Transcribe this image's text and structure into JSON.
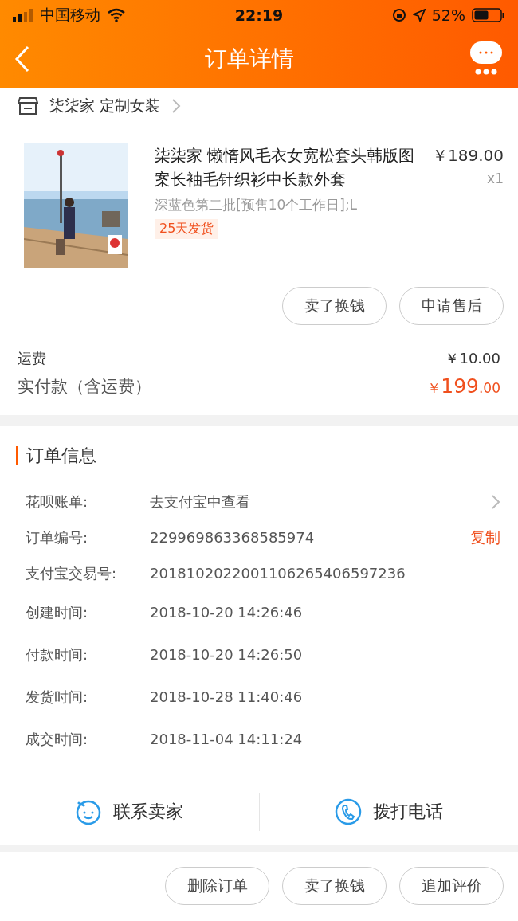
{
  "status_bar": {
    "carrier": "中国移动",
    "time": "22:19",
    "battery": "52%"
  },
  "nav": {
    "title": "订单详情"
  },
  "shop": {
    "name": "柒柒家 定制女装"
  },
  "product": {
    "title": "柒柒家 懒惰风毛衣女宽松套头韩版图案长袖毛针织衫中长款外套",
    "price": "￥189.00",
    "quantity": "x1",
    "sku": "深蓝色第二批[预售10个工作日];L",
    "tag": "25天发货"
  },
  "item_actions": [
    "卖了换钱",
    "申请售后"
  ],
  "fees": [
    {
      "label": "运费",
      "value": "￥10.00",
      "kind": "plain"
    },
    {
      "label": "实付款（含运费）",
      "currency": "￥",
      "value": "199",
      "decimals": ".00",
      "kind": "total"
    }
  ],
  "order_info": {
    "title": "订单信息",
    "rows": [
      {
        "label": "花呗账单:",
        "value": "去支付宝中查看",
        "kind": "link"
      },
      {
        "label": "订单编号:",
        "value": "229969863368585974",
        "kind": "copy",
        "action_text": "复制"
      },
      {
        "label": "支付宝交易号:",
        "value": "2018102022001106265406597236",
        "kind": "plain"
      },
      {
        "label": "创建时间:",
        "value": "2018-10-20 14:26:46",
        "kind": "plain"
      },
      {
        "label": "付款时间:",
        "value": "2018-10-20 14:26:50",
        "kind": "plain"
      },
      {
        "label": "发货时间:",
        "value": "2018-10-28 11:40:46",
        "kind": "plain"
      },
      {
        "label": "成交时间:",
        "value": "2018-11-04 14:11:24",
        "kind": "plain"
      }
    ]
  },
  "contact": [
    {
      "label": "联系卖家",
      "kind": "chat"
    },
    {
      "label": "拨打电话",
      "kind": "phone"
    }
  ],
  "bottom_actions": [
    "删除订单",
    "卖了换钱",
    "追加评价"
  ]
}
